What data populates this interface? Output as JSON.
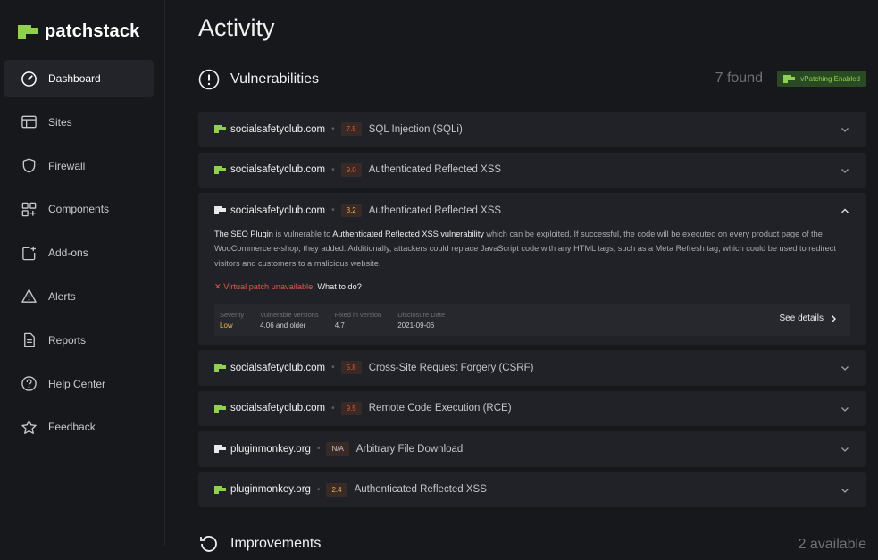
{
  "brand": {
    "name": "patchstack",
    "accent": "#8fd14f"
  },
  "sidebar": {
    "items": [
      {
        "label": "Dashboard",
        "icon": "gauge-icon",
        "active": true
      },
      {
        "label": "Sites",
        "icon": "layout-icon"
      },
      {
        "label": "Firewall",
        "icon": "shield-icon"
      },
      {
        "label": "Components",
        "icon": "components-icon"
      },
      {
        "label": "Add-ons",
        "icon": "add-ons-icon"
      },
      {
        "label": "Alerts",
        "icon": "warning-icon"
      },
      {
        "label": "Reports",
        "icon": "document-icon"
      },
      {
        "label": "Help Center",
        "icon": "help-icon"
      },
      {
        "label": "Feedback",
        "icon": "star-icon"
      }
    ]
  },
  "page": {
    "title": "Activity"
  },
  "vulnerabilities": {
    "title": "Vulnerabilities",
    "count_text": "7 found",
    "vpatching_badge": "vPatching Enabled",
    "items": [
      {
        "domain": "socialsafetyclub.com",
        "score": "7.5",
        "score_color": "#e0583f",
        "title": "SQL Injection (SQLi)",
        "flag": "green"
      },
      {
        "domain": "socialsafetyclub.com",
        "score": "9.0",
        "score_color": "#e0583f",
        "title": "Authenticated Reflected XSS",
        "flag": "green"
      },
      {
        "domain": "socialsafetyclub.com",
        "score": "3.2",
        "score_color": "#e6b34a",
        "title": "Authenticated Reflected XSS",
        "flag": "white",
        "expanded": true
      },
      {
        "domain": "socialsafetyclub.com",
        "score": "5.8",
        "score_color": "#e0583f",
        "title": "Cross-Site Request Forgery (CSRF)",
        "flag": "green"
      },
      {
        "domain": "socialsafetyclub.com",
        "score": "9.5",
        "score_color": "#e0583f",
        "title": "Remote Code Execution (RCE)",
        "flag": "green"
      },
      {
        "domain": "pluginmonkey.org",
        "score": "N/A",
        "score_color": "#c9cacd",
        "title": "Arbitrary File Download",
        "flag": "white"
      },
      {
        "domain": "pluginmonkey.org",
        "score": "2.4",
        "score_color": "#e6b34a",
        "title": "Authenticated Reflected XSS",
        "flag": "green"
      }
    ],
    "expanded_detail": {
      "plugin": "The SEO Plugin",
      "desc_1": " is vulnerable to ",
      "vuln_name": "Authenticated Reflected XSS vulnerability",
      "desc_2": " which can be exploited. If successful, the code will be executed on every product page of the WooCommerce e-shop, they added. Additionally, attackers could replace JavaScript code with any HTML tags, such as a Meta Refresh tag, which could be used to redirect visitors and customers to a malicious website.",
      "vpatch_unavailable": "Virtual patch unavailable.",
      "what_to_do": "What to do?",
      "severity_label": "Severity",
      "severity_value": "Low",
      "vulnerable_versions_label": "Vulnerable versions",
      "vulnerable_versions_value": "4.06 and older",
      "fixed_in_label": "Fixed in version",
      "fixed_in_value": "4.7",
      "disclosure_label": "Disclosure Date",
      "disclosure_value": "2021-09-06",
      "see_details": "See details"
    }
  },
  "improvements": {
    "title": "Improvements",
    "count_text": "2 available"
  }
}
